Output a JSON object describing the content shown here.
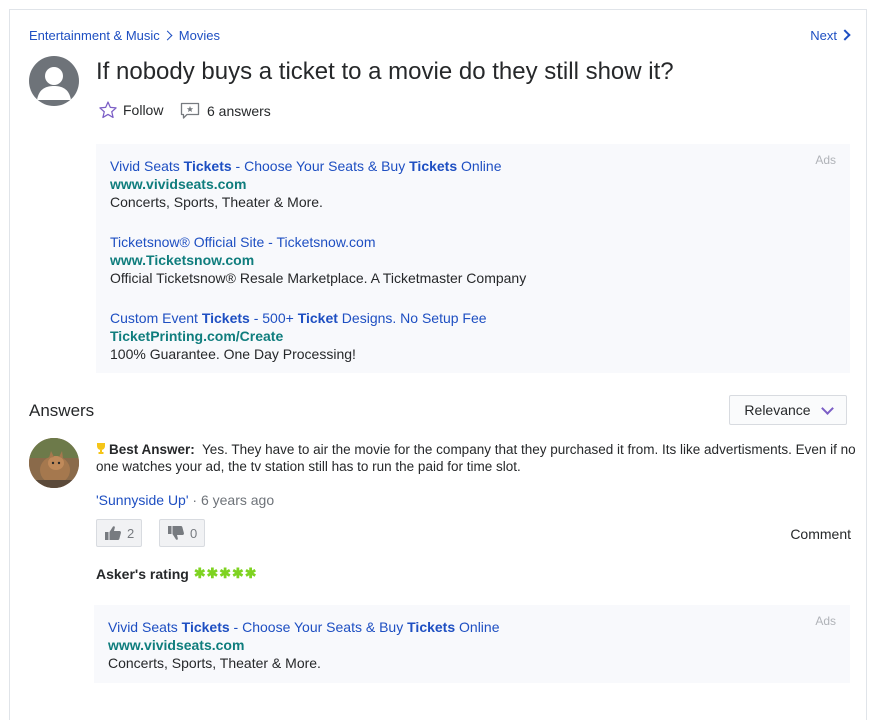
{
  "breadcrumb": {
    "category": "Entertainment & Music",
    "subcategory": "Movies"
  },
  "nav": {
    "next_label": "Next"
  },
  "question": {
    "title": "If nobody buys a ticket to a movie do they still show it?",
    "follow_label": "Follow",
    "answers_count_label": "6 answers"
  },
  "top_ads": {
    "label": "Ads",
    "items": [
      {
        "title_parts": [
          "Vivid Seats ",
          "Tickets",
          " - Choose Your Seats & Buy ",
          "Tickets",
          " Online"
        ],
        "url": "www.vividseats.com",
        "desc": "Concerts, Sports, Theater & More."
      },
      {
        "title_parts": [
          "Ticketsnow® Official Site - Ticketsnow.com"
        ],
        "url": "www.Ticketsnow.com",
        "desc": "Official Ticketsnow® Resale Marketplace. A Ticketmaster Company"
      },
      {
        "title_parts": [
          "Custom Event ",
          "Tickets",
          " - 500+ ",
          "Ticket",
          " Designs. No Setup Fee"
        ],
        "url": "TicketPrinting.com/Create",
        "desc": "100% Guarantee. One Day Processing!"
      }
    ]
  },
  "answers_section": {
    "heading": "Answers",
    "sort_label": "Relevance"
  },
  "best_answer": {
    "label": "Best Answer:",
    "text": "Yes. They have to air the movie for the company that they purchased it from. Its like advertisments. Even if no one watches your ad, the tv station still has to run the paid for time slot.",
    "author": "'Sunnyside Up'",
    "separator": " · ",
    "time": "6 years ago",
    "upvotes": "2",
    "downvotes": "0",
    "comment_label": "Comment",
    "askers_rating_label": "Asker's rating",
    "askers_rating": 5,
    "askers_rating_stars": "✱✱✱✱✱"
  },
  "bottom_ad": {
    "label": "Ads",
    "title_parts": [
      "Vivid Seats ",
      "Tickets",
      " - Choose Your Seats & Buy ",
      "Tickets",
      " Online"
    ],
    "url": "www.vividseats.com",
    "desc": "Concerts, Sports, Theater & More."
  },
  "colors": {
    "link": "#1e4fc2",
    "ad_url": "#0f7d7d",
    "accent": "#7b5ec6",
    "rating_star": "#7ed321",
    "ad_background": "#f8f9fc"
  }
}
